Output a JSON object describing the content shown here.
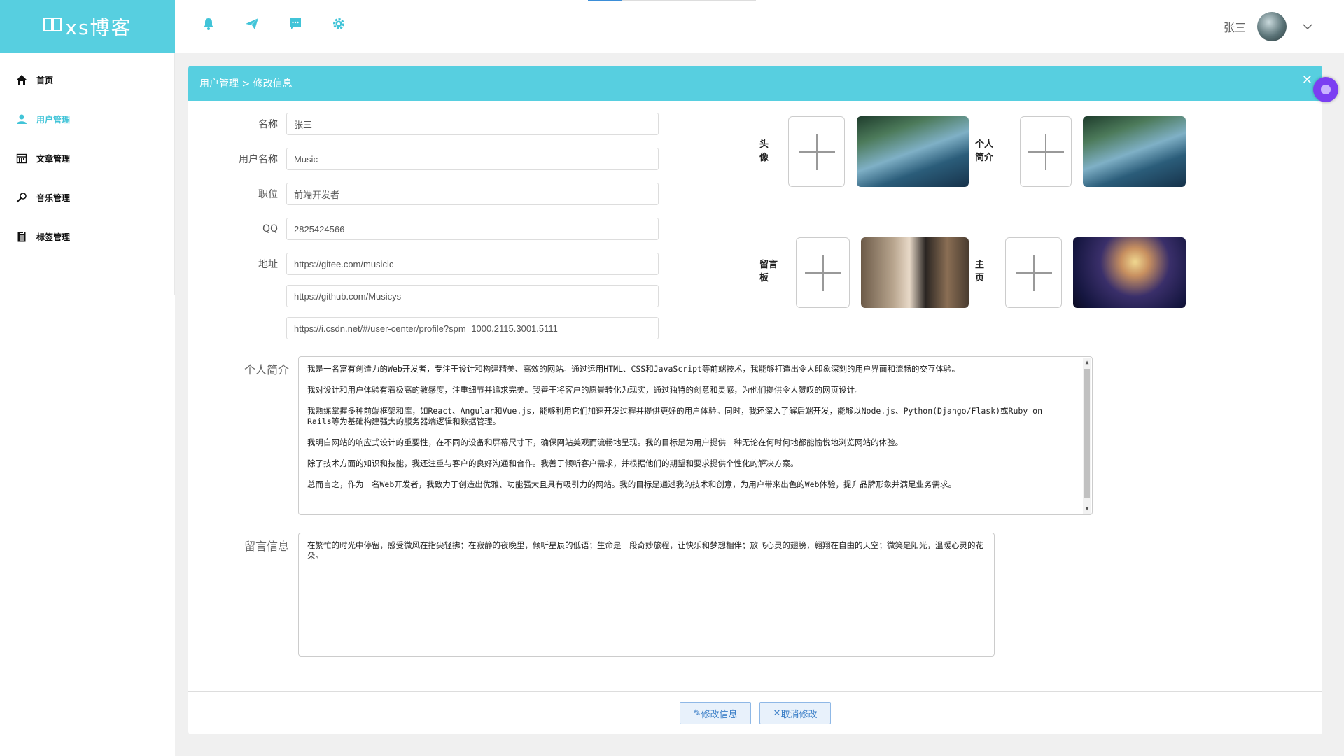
{
  "app": {
    "logo_text": "xs博客",
    "logo_icon": "book-icon"
  },
  "sidebar": {
    "items": [
      {
        "label": "首页",
        "icon": "home-icon",
        "active": false
      },
      {
        "label": "用户管理",
        "icon": "user-icon",
        "active": true
      },
      {
        "label": "文章管理",
        "icon": "calendar-icon",
        "active": false
      },
      {
        "label": "音乐管理",
        "icon": "search-music-icon",
        "active": false
      },
      {
        "label": "标签管理",
        "icon": "clipboard-icon",
        "active": false
      }
    ]
  },
  "topbar": {
    "icons": [
      "bell-icon",
      "paper-plane-icon",
      "chat-icon",
      "gear-icon"
    ],
    "username": "张三",
    "accent": "#41c4d8"
  },
  "panel": {
    "breadcrumb": "用户管理 > 修改信息",
    "header_color": "#57cfe0"
  },
  "form": {
    "name": {
      "label": "名称",
      "value": "张三"
    },
    "username": {
      "label": "用户名称",
      "value": "Music"
    },
    "position": {
      "label": "职位",
      "value": "前端开发者"
    },
    "qq": {
      "label": "QQ",
      "value": "2825424566"
    },
    "address": {
      "label": "地址",
      "values": [
        "https://gitee.com/musicic",
        "https://github.com/Musicys",
        "https://i.csdn.net/#/user-center/profile?spm=1000.2115.3001.5111"
      ]
    },
    "intro": {
      "label": "个人简介",
      "paragraphs": [
        " 我是一名富有创造力的Web开发者，专注于设计和构建精美、高效的网站。通过运用HTML、CSS和JavaScript等前端技术，我能够打造出令人印象深刻的用户界面和流畅的交互体验。",
        "我对设计和用户体验有着极高的敏感度，注重细节并追求完美。我善于将客户的愿景转化为现实，通过独特的创意和灵感，为他们提供令人赞叹的网页设计。",
        "我熟练掌握多种前端框架和库，如React、Angular和Vue.js，能够利用它们加速开发过程并提供更好的用户体验。同时，我还深入了解后端开发，能够以Node.js、Python(Django/Flask)或Ruby on Rails等为基础构建强大的服务器端逻辑和数据管理。",
        "我明白网站的响应式设计的重要性，在不同的设备和屏幕尺寸下，确保网站美观而流畅地呈现。我的目标是为用户提供一种无论在何时何地都能愉悦地浏览网站的体验。",
        "除了技术方面的知识和技能，我还注重与客户的良好沟通和合作。我善于倾听客户需求，并根据他们的期望和要求提供个性化的解决方案。",
        "总而言之，作为一名Web开发者，我致力于创造出优雅、功能强大且具有吸引力的网站。我的目标是通过我的技术和创意，为用户带来出色的Web体验，提升品牌形象并满足业务需求。"
      ]
    },
    "message": {
      "label": "留言信息",
      "value": "在繁忙的时光中停留，感受微风在指尖轻拂；在寂静的夜晚里，倾听星辰的低语；生命是一段奇妙旅程，让快乐和梦想相伴；放飞心灵的翅膀，翱翔在自由的天空；微笑是阳光，温暖心灵的花朵。"
    }
  },
  "images": {
    "avatar_label": "头像",
    "intro_label": "个人简介",
    "board_label": "留言板",
    "home_label": "主页"
  },
  "actions": {
    "submit": "修改信息",
    "cancel": "取消修改"
  }
}
